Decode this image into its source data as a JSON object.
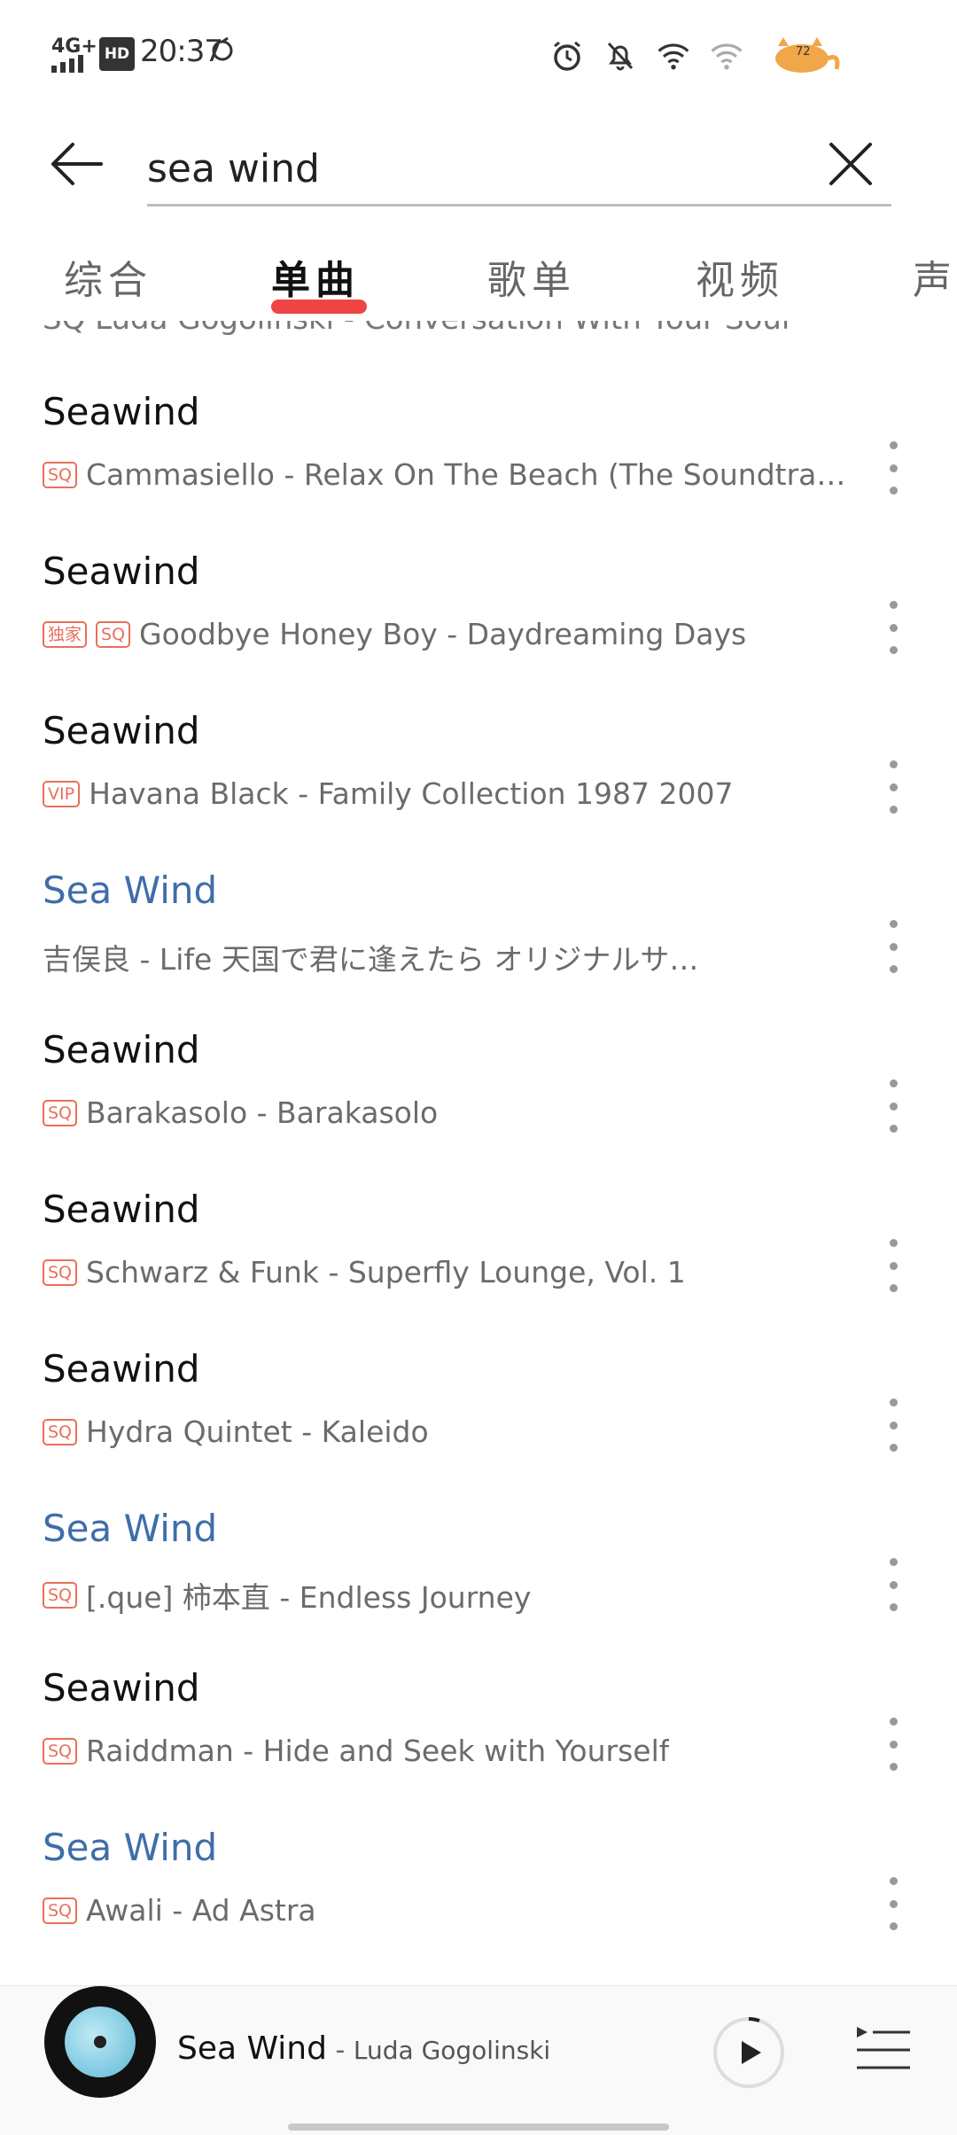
{
  "status_bar": {
    "network": "4G+",
    "hd": "HD",
    "time": "20:37",
    "battery": "72"
  },
  "search": {
    "value": "sea wind",
    "placeholder": ""
  },
  "tabs": [
    {
      "label": "综合",
      "active": false
    },
    {
      "label": "单曲",
      "active": true
    },
    {
      "label": "歌单",
      "active": false
    },
    {
      "label": "视频",
      "active": false
    },
    {
      "label": "声",
      "active": false
    }
  ],
  "partial_row": "SQ Luda Gogolinski - Conversation With Your Soul",
  "results": [
    {
      "title": "Seawind",
      "highlight": false,
      "badges": [
        "SQ"
      ],
      "subtitle": "Cammasiello - Relax On The Beach (The Soundtrack…"
    },
    {
      "title": "Seawind",
      "highlight": false,
      "badges": [
        "独家",
        "SQ"
      ],
      "subtitle": "Goodbye Honey Boy - Daydreaming Days"
    },
    {
      "title": "Seawind",
      "highlight": false,
      "badges": [
        "VIP"
      ],
      "subtitle": "Havana Black - Family Collection 1987 2007"
    },
    {
      "title": "Sea Wind",
      "highlight": true,
      "badges": [],
      "subtitle": "吉俣良 - Life 天国で君に逢えたら オリジナルサ…"
    },
    {
      "title": "Seawind",
      "highlight": false,
      "badges": [
        "SQ"
      ],
      "subtitle": "Barakasolo - Barakasolo"
    },
    {
      "title": "Seawind",
      "highlight": false,
      "badges": [
        "SQ"
      ],
      "subtitle": "Schwarz & Funk - Superfly Lounge, Vol. 1"
    },
    {
      "title": "Seawind",
      "highlight": false,
      "badges": [
        "SQ"
      ],
      "subtitle": "Hydra Quintet - Kaleido"
    },
    {
      "title": "Sea Wind",
      "highlight": true,
      "badges": [
        "SQ"
      ],
      "subtitle": "[.que] 柿本直 - Endless Journey"
    },
    {
      "title": "Seawind",
      "highlight": false,
      "badges": [
        "SQ"
      ],
      "subtitle": "Raiddman - Hide and Seek with Yourself"
    },
    {
      "title": "Sea Wind",
      "highlight": true,
      "badges": [
        "SQ"
      ],
      "subtitle": "Awali - Ad Astra"
    }
  ],
  "player": {
    "title": "Sea Wind",
    "separator": " - ",
    "artist": "Luda Gogolinski"
  },
  "colors": {
    "accent": "#ef4444",
    "highlight_title": "#3f6ea8",
    "badge": "#e9705a"
  }
}
